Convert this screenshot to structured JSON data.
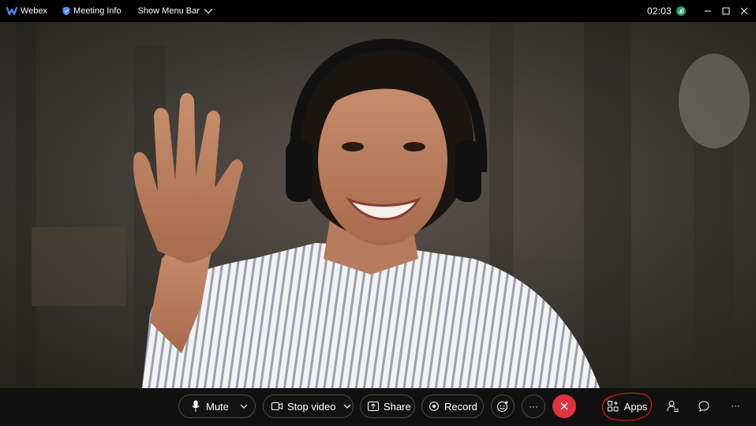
{
  "titlebar": {
    "app_name": "Webex",
    "meeting_info_label": "Meeting Info",
    "show_menu_bar_label": "Show Menu Bar",
    "time": "02:03"
  },
  "controls": {
    "mute_label": "Mute",
    "stop_video_label": "Stop video",
    "share_label": "Share",
    "record_label": "Record",
    "more_label": "···",
    "apps_label": "Apps",
    "overflow_label": "···"
  },
  "colors": {
    "end_call": "#e0323f",
    "signal": "#1d9f6a",
    "webex_blue": "#4d8dff",
    "annotation_circle": "#c8141e"
  },
  "icons": {
    "app": "webex-logo-icon",
    "info": "shield-icon",
    "chevron": "chevron-down-icon",
    "mic": "microphone-icon",
    "camera": "camera-icon",
    "share": "share-icon",
    "record": "record-icon",
    "reactions": "reactions-icon",
    "end": "close-icon",
    "apps": "apps-icon",
    "participants": "participants-icon",
    "chat": "chat-icon"
  }
}
